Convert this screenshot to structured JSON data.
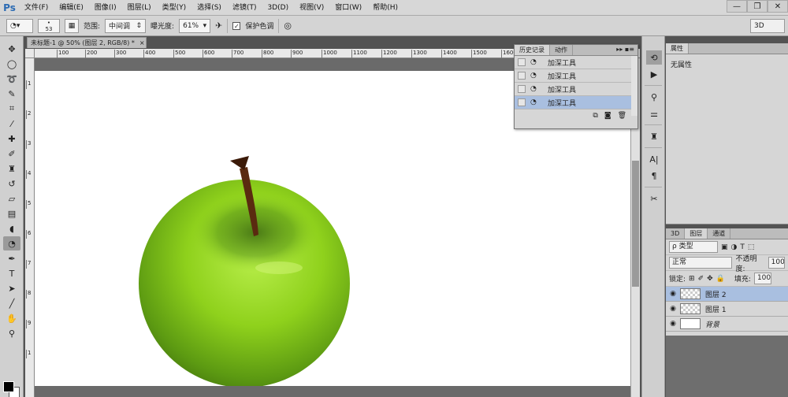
{
  "menubar": {
    "logo": "Ps",
    "items": [
      "文件(F)",
      "编辑(E)",
      "图像(I)",
      "图层(L)",
      "类型(Y)",
      "选择(S)",
      "滤镜(T)",
      "3D(D)",
      "视图(V)",
      "窗口(W)",
      "帮助(H)"
    ],
    "window_controls": [
      "—",
      "❐",
      "✕"
    ]
  },
  "options": {
    "brush_size": "53",
    "range_label": "范围:",
    "range_value": "中间调",
    "exposure_label": "曝光度:",
    "exposure_value": "61%",
    "protect_tones_label": "保护色调",
    "workspace": "3D"
  },
  "document": {
    "tab_title": "未标题-1 @ 50% (图层 2, RGB/8) *",
    "close": "×",
    "ruler_h": [
      "100",
      "200",
      "300",
      "400",
      "500",
      "600",
      "700",
      "800",
      "900",
      "1000",
      "1100",
      "1200",
      "1300",
      "1400",
      "1500",
      "1600"
    ],
    "ruler_v": [
      "1",
      "2",
      "3",
      "4",
      "5",
      "6",
      "7",
      "8",
      "9",
      "1"
    ]
  },
  "history": {
    "tabs": [
      "历史记录",
      "动作"
    ],
    "panel_controls": "▸▸ ▪≡",
    "items": [
      {
        "label": "加深工具",
        "selected": false
      },
      {
        "label": "加深工具",
        "selected": false
      },
      {
        "label": "加深工具",
        "selected": false
      },
      {
        "label": "加深工具",
        "selected": true
      }
    ],
    "footer_icons": [
      "new-document-from-state-icon",
      "camera-icon",
      "trash-icon"
    ]
  },
  "properties": {
    "tab": "属性",
    "empty_text": "无属性"
  },
  "layers": {
    "tabs": [
      "3D",
      "图层",
      "通道"
    ],
    "filter_label": "ρ 类型",
    "blend_mode": "正常",
    "opacity_label": "不透明度:",
    "opacity_value": "100%",
    "lock_label": "锁定:",
    "fill_label": "填充:",
    "fill_value": "100%",
    "items": [
      {
        "name": "图层 2",
        "selected": true
      },
      {
        "name": "图层 1",
        "selected": false
      },
      {
        "name": "背景",
        "selected": false
      }
    ]
  },
  "colors": {
    "accent_selection": "#a9bfe0",
    "apple_green": "#8fd11c",
    "stem_brown": "#5a2a10"
  }
}
